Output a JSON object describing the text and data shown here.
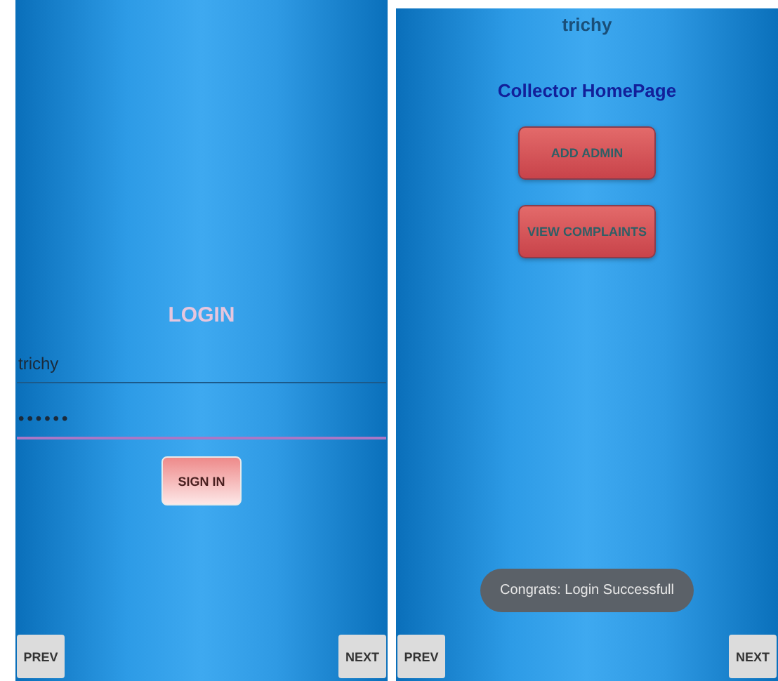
{
  "login_screen": {
    "title": "LOGIN",
    "username": "trichy",
    "password_mask": "••••••",
    "sign_in_button": "SIGN IN",
    "prev_button": "PREV",
    "next_button": "NEXT"
  },
  "home_screen": {
    "username": "trichy",
    "title": "Collector HomePage",
    "buttons": [
      "ADD ADMIN",
      "VIEW COMPLAINTS"
    ],
    "toast": "Congrats: Login Successfull",
    "prev_button": "PREV",
    "next_button": "NEXT"
  }
}
